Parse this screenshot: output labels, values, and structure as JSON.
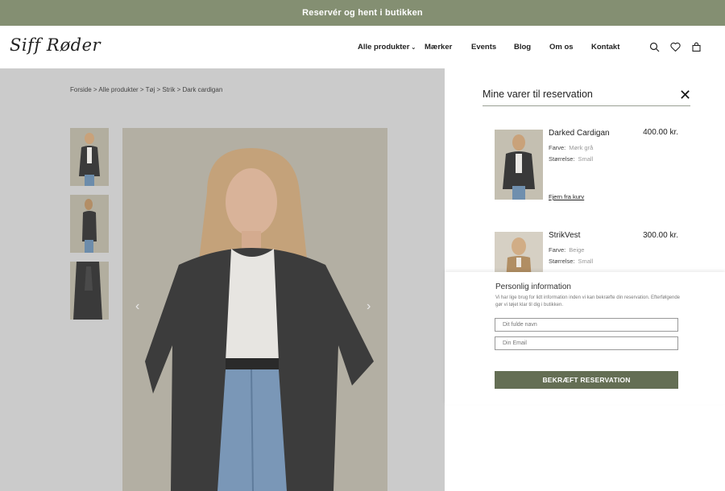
{
  "topbar": {
    "message": "Reservér og hent i butikken"
  },
  "header": {
    "logo": "Siff Røder",
    "nav": [
      {
        "label": "Alle produkter",
        "has_dropdown": true
      },
      {
        "label": "Mærker"
      },
      {
        "label": "Events"
      },
      {
        "label": "Blog"
      },
      {
        "label": "Om os"
      },
      {
        "label": "Kontakt"
      }
    ],
    "icons": [
      "search-icon",
      "heart-icon",
      "bag-icon"
    ]
  },
  "breadcrumb": "Forside > Alle produkter > Tøj > Strik  > Dark cardigan",
  "gallery": {
    "prev_arrow": "‹",
    "next_arrow": "›"
  },
  "reservation": {
    "title": "Mine varer til reservation",
    "close": "✕",
    "items": [
      {
        "name": "Darked Cardigan",
        "price": "400.00 kr.",
        "color_label": "Farve:",
        "color_value": "Mørk grå",
        "size_label": "Størrelse:",
        "size_value": "Small",
        "remove": "Fjern fra kurv"
      },
      {
        "name": "StrikVest",
        "price": "300.00 kr.",
        "color_label": "Farve:",
        "color_value": "Beige",
        "size_label": "Størrelse:",
        "size_value": "Small"
      }
    ]
  },
  "personal_info": {
    "title": "Personlig information",
    "description": "Vi har lige brug for lidt information inden vi kan bekræfte din reservation. Efterfølgende gør vi tøjet klar til dig i butikken.",
    "name_placeholder": "Dit fulde navn",
    "email_placeholder": "Din Email",
    "confirm": "BEKRÆFT RESERVATION"
  },
  "colors": {
    "accent": "#848f72",
    "button": "#646e54",
    "overlay": "#cbcbcb"
  }
}
